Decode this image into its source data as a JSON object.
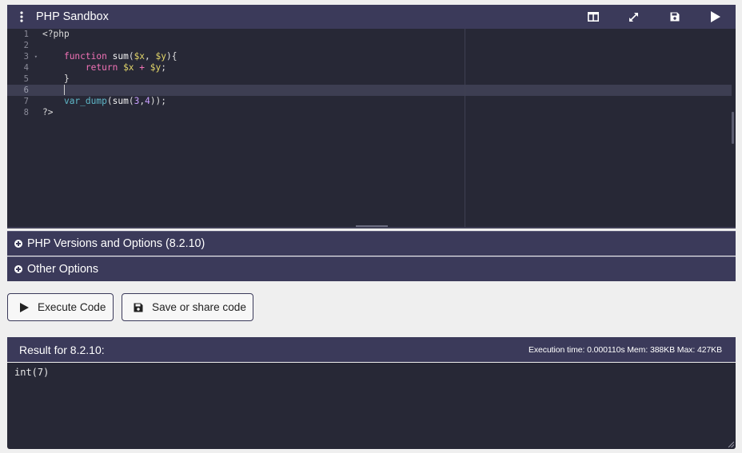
{
  "header": {
    "title": "PHP Sandbox"
  },
  "icons": {
    "menu": "vertical-dots-icon",
    "layout": "split-columns-icon",
    "fullscreen": "expand-arrows-icon",
    "save": "floppy-disk-icon",
    "run": "play-icon"
  },
  "editor": {
    "line_numbers": [
      "1",
      "2",
      "3",
      "4",
      "5",
      "6",
      "7",
      "8"
    ],
    "active_line": 6
  },
  "options": {
    "versions_label": "PHP Versions and Options (8.2.10)",
    "other_label": "Other Options"
  },
  "buttons": {
    "execute_label": "Execute Code",
    "save_label": "Save or share code"
  },
  "result": {
    "title": "Result for 8.2.10:",
    "stats": "Execution time: 0.000110s Mem: 388KB Max: 427KB",
    "output": "int(7)"
  },
  "colors": {
    "bar": "#3b3a5a",
    "editor_bg": "#272836",
    "keyword": "#f172b6",
    "variable": "#e3d66a",
    "number": "#c89eff"
  }
}
